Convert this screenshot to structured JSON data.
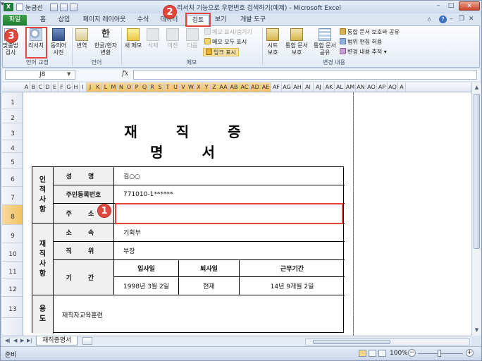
{
  "window": {
    "title": "리서치 기능으로 우편번호 검색하기(예제) - Microsoft Excel",
    "quick_access_label": "눈금선"
  },
  "tabs": [
    "파일",
    "홈",
    "삽입",
    "페이지 레이아웃",
    "수식",
    "데이터",
    "검토",
    "보기",
    "개발 도구"
  ],
  "ribbon": {
    "proofing": {
      "spell_check": "맞춤법\n검사",
      "research": "리서치",
      "thesaurus": "동의어\n사전",
      "group_label": "언어 교정"
    },
    "language": {
      "translate": "번역",
      "hangul_hanja": "한글/한자\n변환",
      "group_label": "언어"
    },
    "comments": {
      "new_comment": "새 메모",
      "delete": "삭제",
      "previous": "이전",
      "next": "다음",
      "show_hide": "메모 표시/숨기기",
      "show_all": "메모 모두 표시",
      "show_ink": "잉크 표시",
      "group_label": "메모"
    },
    "changes": {
      "protect_sheet": "시트\n보호",
      "protect_workbook": "통합 문서\n보호",
      "share_workbook": "통합 문서\n공유",
      "protect_and_share": "통합 문서 보호와 공유",
      "allow_edit_ranges": "범위 편집 허용",
      "track_changes": "변경 내용 추적",
      "group_label": "변경 내용"
    }
  },
  "formula_bar": {
    "name_box": "J8",
    "fx": "fx",
    "formula": ""
  },
  "columns": [
    "A",
    "B",
    "C",
    "D",
    "E",
    "F",
    "G",
    "H",
    "I",
    "J",
    "K",
    "L",
    "M",
    "N",
    "O",
    "P",
    "Q",
    "R",
    "S",
    "T",
    "U",
    "V",
    "W",
    "X",
    "Y",
    "Z",
    "AA",
    "AB",
    "AC",
    "AD",
    "AE",
    "AF",
    "AG",
    "AH",
    "AI",
    "AJ",
    "AK",
    "AL",
    "AM",
    "AN",
    "AO",
    "AP",
    "AQ",
    "A"
  ],
  "rows": [
    "1",
    "2",
    "3",
    "4",
    "5",
    "6",
    "7",
    "8",
    "9",
    "10",
    "11",
    "12",
    "13"
  ],
  "document": {
    "title": "재 직 증 명 서",
    "personal": {
      "section_label": "인\n적\n사\n항",
      "name_label": "성 명",
      "name_value": "김○○",
      "id_label": "주민등록번호",
      "id_value": "771010-1******",
      "address_label": "주 소",
      "address_value": ""
    },
    "employment": {
      "section_label": "재\n직\n사\n항",
      "dept_label": "소 속",
      "dept_value": "기획부",
      "position_label": "직 위",
      "position_value": "부장",
      "period_label": "기 간",
      "join_header": "입사일",
      "leave_header": "퇴사일",
      "tenure_header": "근무기간",
      "join_value": "1998년 3월 2일",
      "leave_value": "현재",
      "tenure_value": "14년  9개월  2일"
    },
    "purpose": {
      "label": "용\n도",
      "value": "재직자교육훈련"
    }
  },
  "callouts": [
    "1",
    "2",
    "3"
  ],
  "sheet_tab": "재직증명서",
  "status": {
    "ready": "준비",
    "zoom": "100%"
  },
  "colors": {
    "accent_green": "#1e7a2e",
    "highlight_red": "#e4433f",
    "selected_header": "#f1c15e"
  }
}
